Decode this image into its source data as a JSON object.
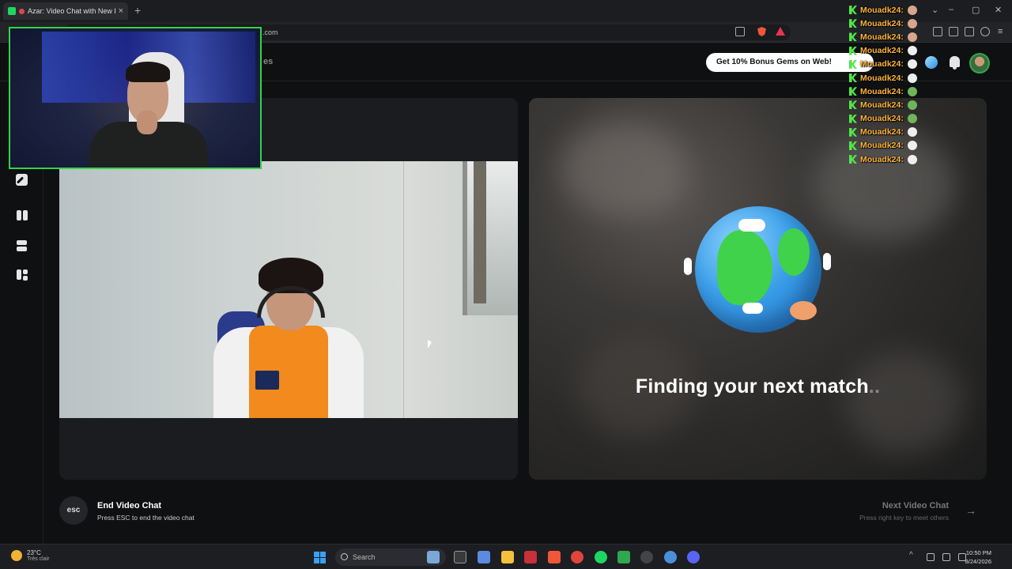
{
  "browser": {
    "tab_title": "Azar: Video Chat with New Pe",
    "tab_close": "×",
    "new_tab": "+",
    "url_suffix": ".com"
  },
  "header": {
    "partial_label": "es",
    "promo_label": "Get 10% Bonus Gems on Web!"
  },
  "right_panel": {
    "status_text": "Finding your next match",
    "status_dots": ".."
  },
  "bottom": {
    "esc_label": "esc",
    "end_title": "End Video Chat",
    "end_subtitle": "Press ESC to end the video chat",
    "next_title": "Next Video Chat",
    "next_subtitle": "Press right key to meet others",
    "next_arrow": "→"
  },
  "chat_overlay": {
    "messages": [
      {
        "user": "Mouadk24:",
        "emote": "face-emote"
      },
      {
        "user": "Mouadk24:",
        "emote": "face-emote"
      },
      {
        "user": "Mouadk24:",
        "emote": "face-emote"
      },
      {
        "user": "Mouadk24:",
        "emote": "ghost-emote"
      },
      {
        "user": "Mouadk24:",
        "emote": "ghost-emote"
      },
      {
        "user": "Mouadk24:",
        "emote": "ghost-emote"
      },
      {
        "user": "Mouadk24:",
        "emote": "frog-emote"
      },
      {
        "user": "Mouadk24:",
        "emote": "frog-emote"
      },
      {
        "user": "Mouadk24:",
        "emote": "frog-emote"
      },
      {
        "user": "Mouadk24:",
        "emote": "ghost-emote"
      },
      {
        "user": "Mouadk24:",
        "emote": "ghost-emote"
      },
      {
        "user": "Mouadk24:",
        "emote": "ghost-emote"
      }
    ]
  },
  "taskbar": {
    "temperature": "23°C",
    "weather_desc": "Très clair",
    "search_placeholder": "Search",
    "time": "10:50 PM",
    "date": "8/24/2026"
  },
  "colors": {
    "accent_green": "#35d24a",
    "chat_name": "#ffb33a",
    "panel_bg": "#1b1c1f"
  }
}
